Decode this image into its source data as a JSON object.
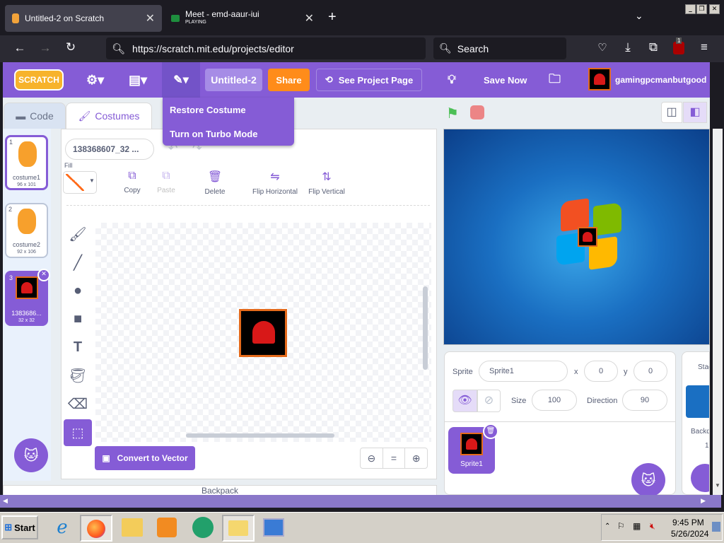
{
  "browser": {
    "tabs": [
      {
        "label": "Untitled-2 on Scratch",
        "active": true
      },
      {
        "label": "Meet - emd-aaur-iui",
        "sublabel": "PLAYING",
        "active": false
      }
    ],
    "new_tab": "+",
    "url": "https://scratch.mit.edu/projects/editor",
    "search_placeholder": "Search",
    "badge": "1"
  },
  "scratch": {
    "logo": "SCRATCH",
    "title_field": "Untitled-2",
    "share": "Share",
    "see_project": "See Project Page",
    "save_now": "Save Now",
    "username": "gamingpcmanbutgood",
    "dropdown": [
      "Restore Costume",
      "Turn on Turbo Mode"
    ],
    "tabs": {
      "code": "Code",
      "costumes": "Costumes"
    },
    "costumes": [
      {
        "num": "1",
        "name": "costume1",
        "size": "96 x 101"
      },
      {
        "num": "2",
        "name": "costume2",
        "size": "92 x 106"
      },
      {
        "num": "3",
        "name": "1383686...",
        "size": "32 x 32"
      }
    ],
    "paint": {
      "costume_name": "138368607_32 ...",
      "fill_label": "Fill",
      "copy": "Copy",
      "paste": "Paste",
      "delete": "Delete",
      "flip_h": "Flip Horizontal",
      "flip_v": "Flip Vertical",
      "convert": "Convert to Vector",
      "zoom_eq": "="
    },
    "backpack": "Backpack",
    "sprite": {
      "sprite_label": "Sprite",
      "sprite_name": "Sprite1",
      "x_label": "x",
      "x": "0",
      "y_label": "y",
      "y": "0",
      "size_label": "Size",
      "size": "100",
      "direction_label": "Direction",
      "direction": "90",
      "tile_name": "Sprite1"
    },
    "stage": {
      "label": "Stag",
      "backdrops": "Backd",
      "count": "1"
    }
  },
  "taskbar": {
    "start": "Start",
    "time": "9:45 PM",
    "date": "5/26/2024"
  }
}
